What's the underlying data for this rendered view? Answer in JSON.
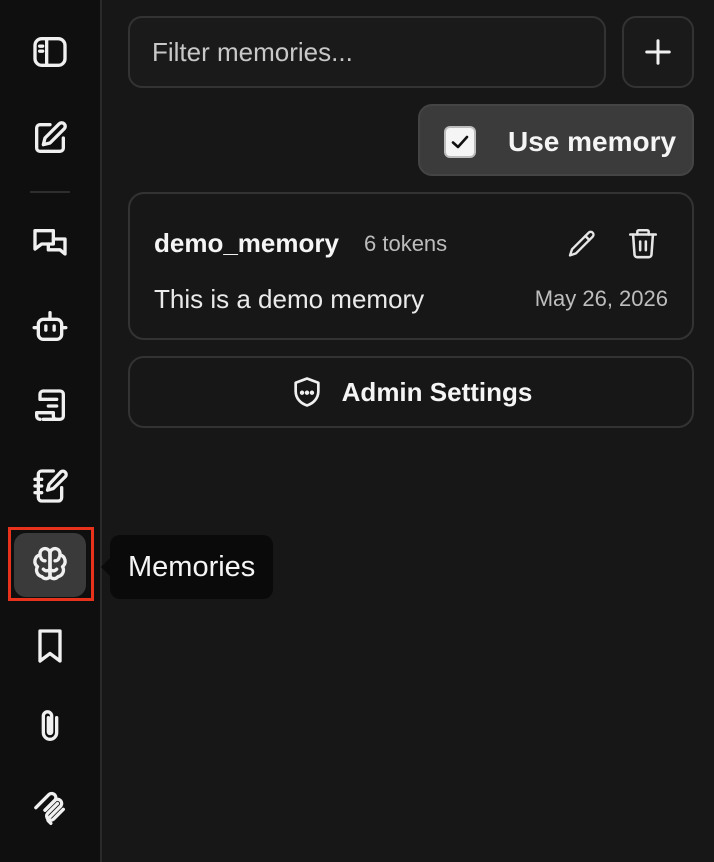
{
  "sidebar": {
    "items": [
      {
        "icon": "sidebar-toggle-icon"
      },
      {
        "icon": "new-chat-icon"
      },
      {
        "icon": "chats-icon"
      },
      {
        "icon": "agents-icon"
      },
      {
        "icon": "prompts-icon"
      },
      {
        "icon": "notes-icon"
      },
      {
        "icon": "memories-icon",
        "active": true
      },
      {
        "icon": "bookmark-icon"
      },
      {
        "icon": "attachments-icon"
      },
      {
        "icon": "mcp-icon"
      }
    ]
  },
  "tooltip": {
    "label": "Memories"
  },
  "filter": {
    "placeholder": "Filter memories..."
  },
  "use_memory": {
    "label": "Use memory",
    "checked": true
  },
  "memories": [
    {
      "name": "demo_memory",
      "tokens": "6 tokens",
      "content": "This is a demo memory",
      "date": "May 26, 2026"
    }
  ],
  "admin": {
    "label": "Admin Settings"
  },
  "colors": {
    "background": "#171717",
    "rail": "#0f0f0f",
    "highlight": "#e8321c",
    "active_item": "#3a3a3a"
  }
}
